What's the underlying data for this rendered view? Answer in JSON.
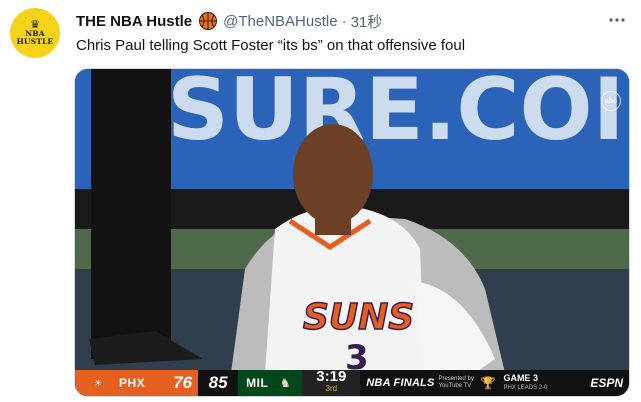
{
  "tweet": {
    "avatar": {
      "line1": "NBA",
      "line2": "HUSTLE"
    },
    "display_name": "THE NBA Hustle",
    "verified_icon": "basketball-icon",
    "handle": "@TheNBAHustle",
    "separator": "·",
    "time": "31秒",
    "text": "Chris Paul telling Scott Foster “its bs” on that offensive foul",
    "more_icon": "more-dots-icon"
  },
  "media": {
    "network_bug": "abc",
    "jersey_text": "SUNS",
    "jersey_number": "3",
    "scorebug": {
      "home_team": "PHX",
      "home_score": "76",
      "away_score": "85",
      "away_team": "MIL",
      "clock": "3:19",
      "period": "3rd",
      "finals_logo": "NBA FINALS",
      "sponsor": "Presented by YouTube TV",
      "game_label": "GAME 3",
      "series": "PHX LEADS 2-0",
      "network": "ESPN"
    }
  },
  "colors": {
    "suns_orange": "#e56020",
    "bucks_green": "#00471b",
    "court_blue": "#1d3a6a",
    "avatar_yellow": "#f5d31a"
  }
}
